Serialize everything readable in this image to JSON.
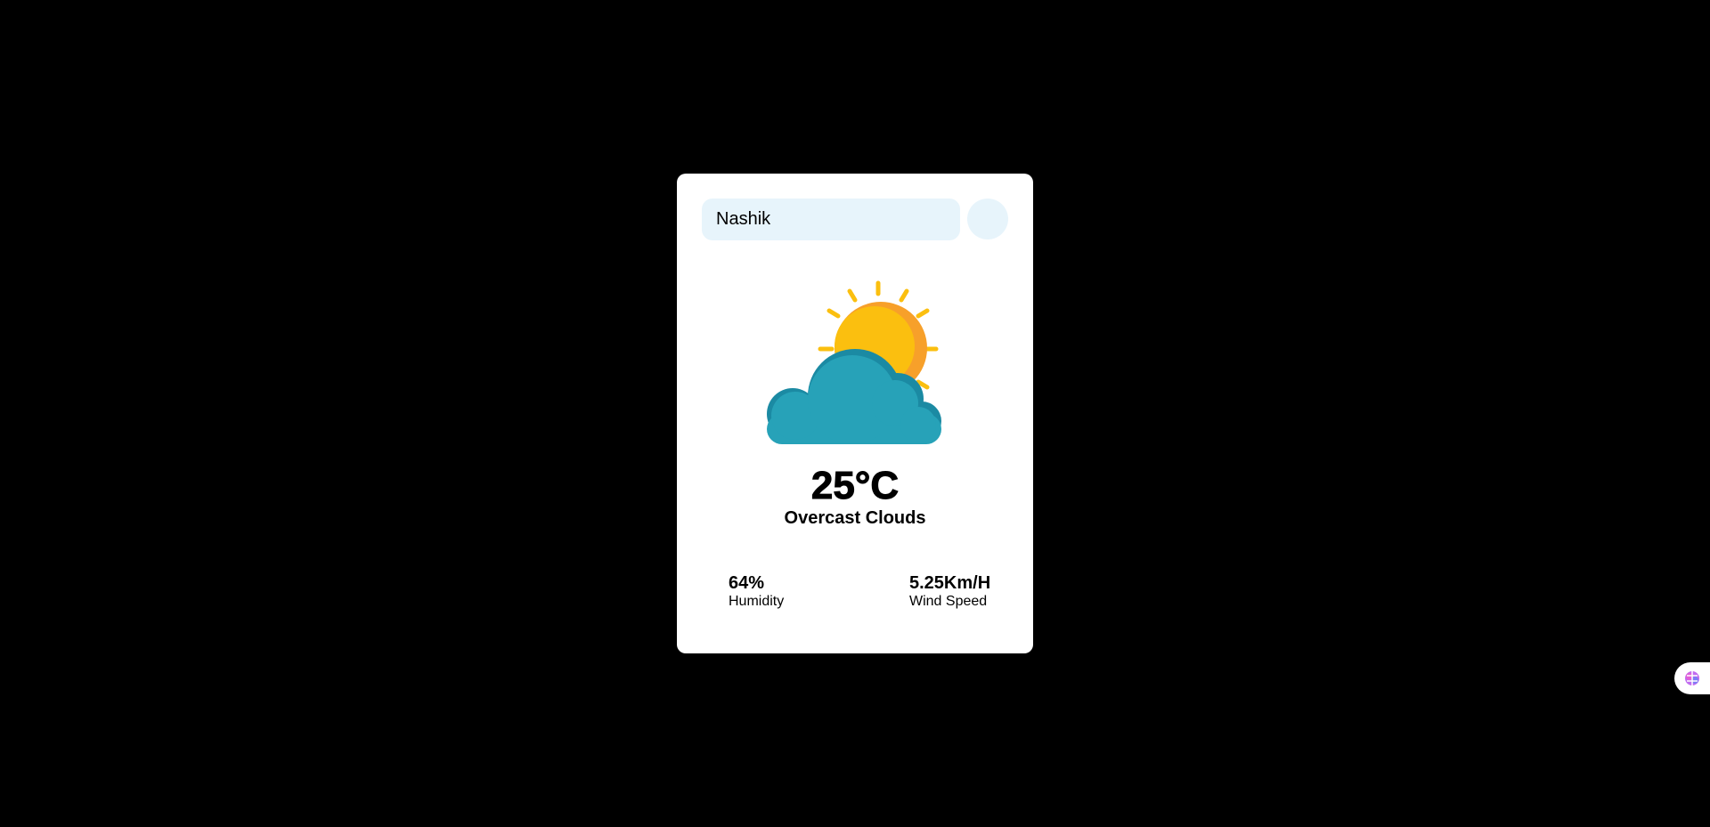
{
  "search": {
    "value": "Nashik",
    "button_icon": "search-icon"
  },
  "weather": {
    "icon": "sun-behind-cloud-icon",
    "temperature": "25°C",
    "description": "Overcast Clouds",
    "humidity_value": "64%",
    "humidity_label": "Humidity",
    "wind_value": "5.25Km/H",
    "wind_label": "Wind Speed"
  },
  "extension_widget": {
    "icon": "brain-icon"
  },
  "colors": {
    "background": "#000000",
    "card": "#ffffff",
    "input_bg": "#e7f4fb",
    "sun": "#fbbf0f",
    "sun_shade": "#f7a02a",
    "cloud": "#27a2b8",
    "cloud_shade": "#1b8aa3"
  }
}
